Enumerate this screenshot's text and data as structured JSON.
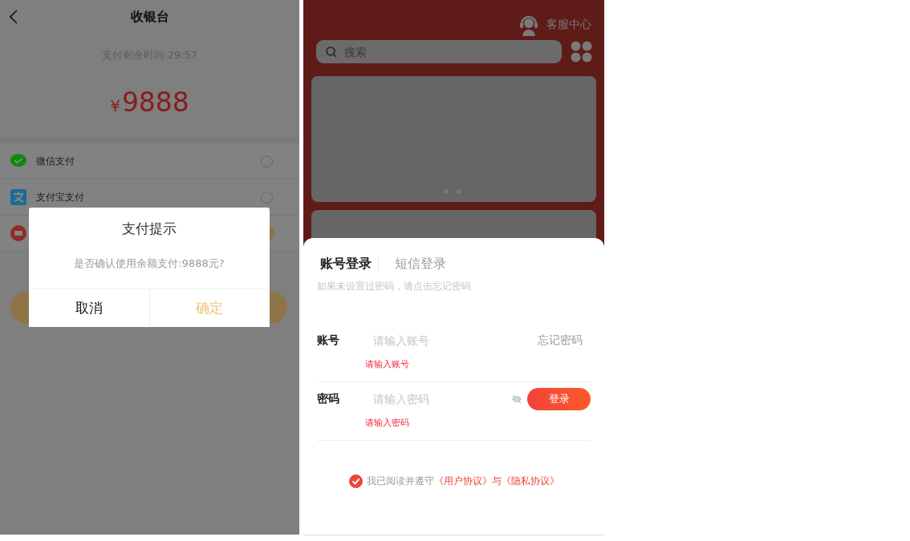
{
  "cashier": {
    "title": "收银台",
    "countdown": "支付剩余时间 29:57",
    "currency": "¥",
    "amount": "9888",
    "methods": [
      {
        "label": "微信支付",
        "kind": "wechat",
        "selected": false
      },
      {
        "label": "支付宝支付",
        "kind": "alipay",
        "selected": false
      },
      {
        "kind": "balance",
        "selected": true
      }
    ],
    "dialog": {
      "title": "支付提示",
      "message": "是否确认使用余额支付:9888元?",
      "buttons": [
        {
          "label": "取消",
          "kind": "cancel"
        },
        {
          "label": "确定",
          "kind": "confirm"
        }
      ]
    }
  },
  "login": {
    "service": "客服中心",
    "search": {
      "placeholder": "搜索"
    },
    "tabs": [
      {
        "label": "账号登录",
        "selected": true
      },
      {
        "label": "短信登录",
        "selected": false
      }
    ],
    "hint": "如果未设置过密码，请点击忘记密码",
    "fields": [
      {
        "kind": "account",
        "label": "账号",
        "placeholder": "请输入账号",
        "error": "请输入账号",
        "action": "忘记密码"
      },
      {
        "kind": "password",
        "label": "密码",
        "placeholder": "请输入密码",
        "error": "请输入密码",
        "action": "登录"
      }
    ],
    "agreement": {
      "checked": true,
      "text": "我已阅读并遵守",
      "links": [
        "《用户协议》",
        "《隐私协议》"
      ],
      "joiner": "与"
    }
  }
}
